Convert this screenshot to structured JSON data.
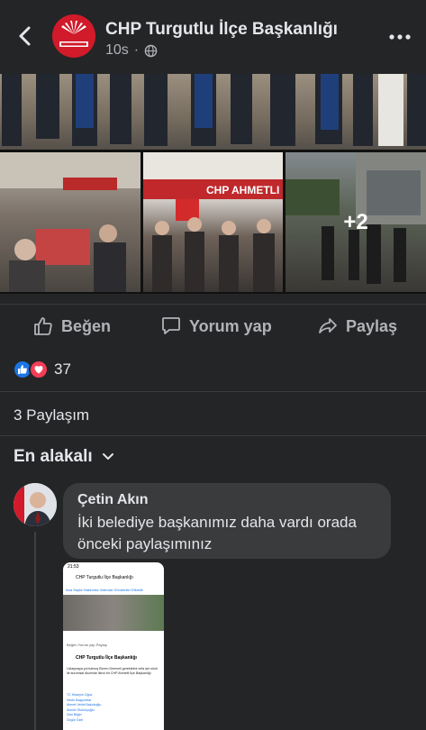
{
  "header": {
    "page_name": "CHP Turgutlu İlçe Başkanlığı",
    "time": "10s",
    "separator": "·",
    "back_icon": "chevron-left-icon",
    "audience_icon": "globe-icon",
    "more_icon": "more-horizontal-icon"
  },
  "media": {
    "extra_count": "+2"
  },
  "actions": {
    "like_label": "Beğen",
    "comment_label": "Yorum yap",
    "share_label": "Paylaş"
  },
  "reactions": {
    "count": "37",
    "types": [
      "like",
      "love"
    ]
  },
  "shares_label": "3 Paylaşım",
  "sort_label": "En alakalı",
  "comment": {
    "author": "Çetin Akın",
    "text": "İki belediye başkanımız daha vardı orada önceki paylaşımınız"
  },
  "attached_screenshot": {
    "status_time": "21:53",
    "page_name": "CHP Turgutlu İlçe Başkanlığı",
    "tabs": "Ana Sayfa   Hakkında   Videolar   Gönderiler   Etkinlik",
    "actions": "Beğen        Yorum yap        Paylaş",
    "post_author": "CHP Turgutlu İlçe Başkanlığı",
    "body": "Uzlaşmaya yol tutmuş Ekrem Dereceli gerektirimi vefa için sözü ile kurumsal düzende ikinci bir CHP Ahmetli İlçe Başkanlığı",
    "names": [
      "TC Hüseyin Oğuz",
      "Nevin Başçımbar",
      "Ahmet Vehbi Bakırlıoğlu",
      "Ahmet Ökünüçoğlu",
      "Zeki Bilgin",
      "Özgür Özel"
    ]
  },
  "colors": {
    "background": "#242526",
    "bubble": "#3a3b3c",
    "text_primary": "#e4e6eb",
    "text_secondary": "#b0b3b8",
    "like_blue": "#1b74e4",
    "love_red": "#f33e58",
    "chp_red": "#d11a2a"
  }
}
